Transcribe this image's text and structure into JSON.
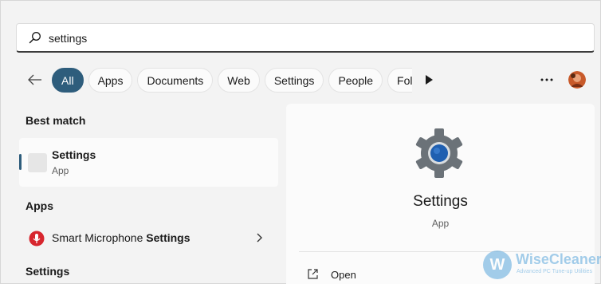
{
  "search": {
    "value": "settings"
  },
  "filters": [
    {
      "label": "All",
      "active": true
    },
    {
      "label": "Apps"
    },
    {
      "label": "Documents"
    },
    {
      "label": "Web"
    },
    {
      "label": "Settings"
    },
    {
      "label": "People"
    },
    {
      "label": "Folde"
    }
  ],
  "sections": {
    "best_match": "Best match",
    "apps": "Apps",
    "settings": "Settings"
  },
  "best_match": {
    "title": "Settings",
    "subtitle": "App"
  },
  "apps_list": [
    {
      "label_prefix": "Smart Microphone ",
      "label_match": "Settings"
    }
  ],
  "detail": {
    "title": "Settings",
    "subtitle": "App",
    "open_label": "Open"
  },
  "watermark": {
    "logo_letter": "W",
    "name": "WiseCleaner",
    "tagline": "Advanced PC Tune-up Utilities"
  },
  "colors": {
    "accent": "#2e5d7c",
    "gear": "#6b7278",
    "gear_center": "#1f5fb0"
  },
  "icons": [
    "search-icon",
    "back-arrow-icon",
    "play-icon",
    "more-icon",
    "chevron-right-icon",
    "gear-icon",
    "open-external-icon",
    "microphone-icon"
  ]
}
